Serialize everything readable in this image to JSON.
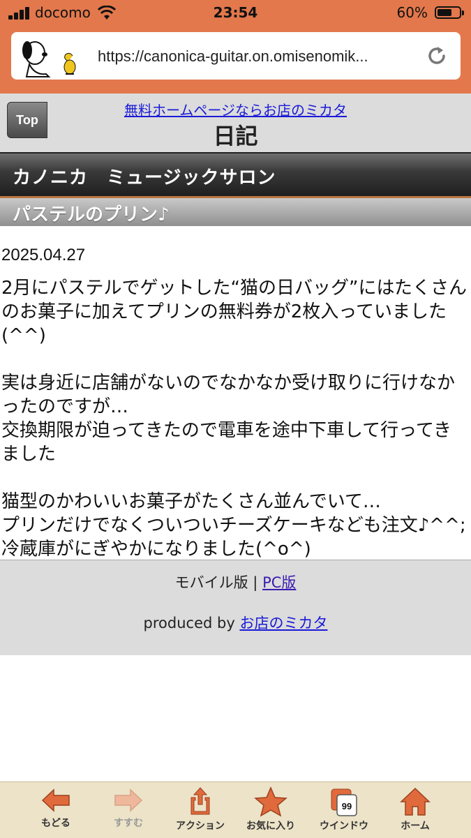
{
  "status_bar": {
    "carrier": "docomo",
    "time": "23:54",
    "battery": "60%"
  },
  "browser": {
    "url": "https://canonica-guitar.on.omisenomik..."
  },
  "header": {
    "top_button": "Top",
    "free_homepage_link": "無料ホームページならお店のミカタ",
    "page_title": "日記"
  },
  "shop": {
    "name": "カノニカ　ミュージックサロン"
  },
  "article": {
    "title": "パステルのプリン♪",
    "date": "2025.04.27",
    "paragraphs": [
      "2月にパステルでゲットした“猫の日バッグ”にはたくさんのお菓子に加えてプリンの無料券が2枚入っていました(^^)",
      "実は身近に店舗がないのでなかなか受け取りに行けなかったのですが…\n交換期限が迫ってきたので電車を途中下車して行ってきました",
      "猫型のかわいいお菓子がたくさん並んでいて…\nプリンだけでなくついついチーズケーキなども注文♪^^;\n冷蔵庫がにぎやかになりました(^o^)"
    ]
  },
  "footer": {
    "mobile_label": "モバイル版",
    "separator": "|",
    "pc_link": "PC版",
    "produced_by": "produced by",
    "credit_link": "お店のミカタ"
  },
  "toolbar": {
    "items": [
      {
        "label": "もどる",
        "icon": "back-arrow-icon"
      },
      {
        "label": "すすむ",
        "icon": "forward-arrow-icon"
      },
      {
        "label": "アクション",
        "icon": "share-icon"
      },
      {
        "label": "お気に入り",
        "icon": "star-icon"
      },
      {
        "label": "ウインドウ",
        "icon": "windows-icon",
        "badge": "99"
      },
      {
        "label": "ホーム",
        "icon": "home-icon"
      }
    ]
  },
  "colors": {
    "browser_chrome": "#e2784c",
    "toolbar_bg": "#ece3c8",
    "icon_orange": "#e06a3c",
    "link_blue": "#1a1ad8"
  }
}
